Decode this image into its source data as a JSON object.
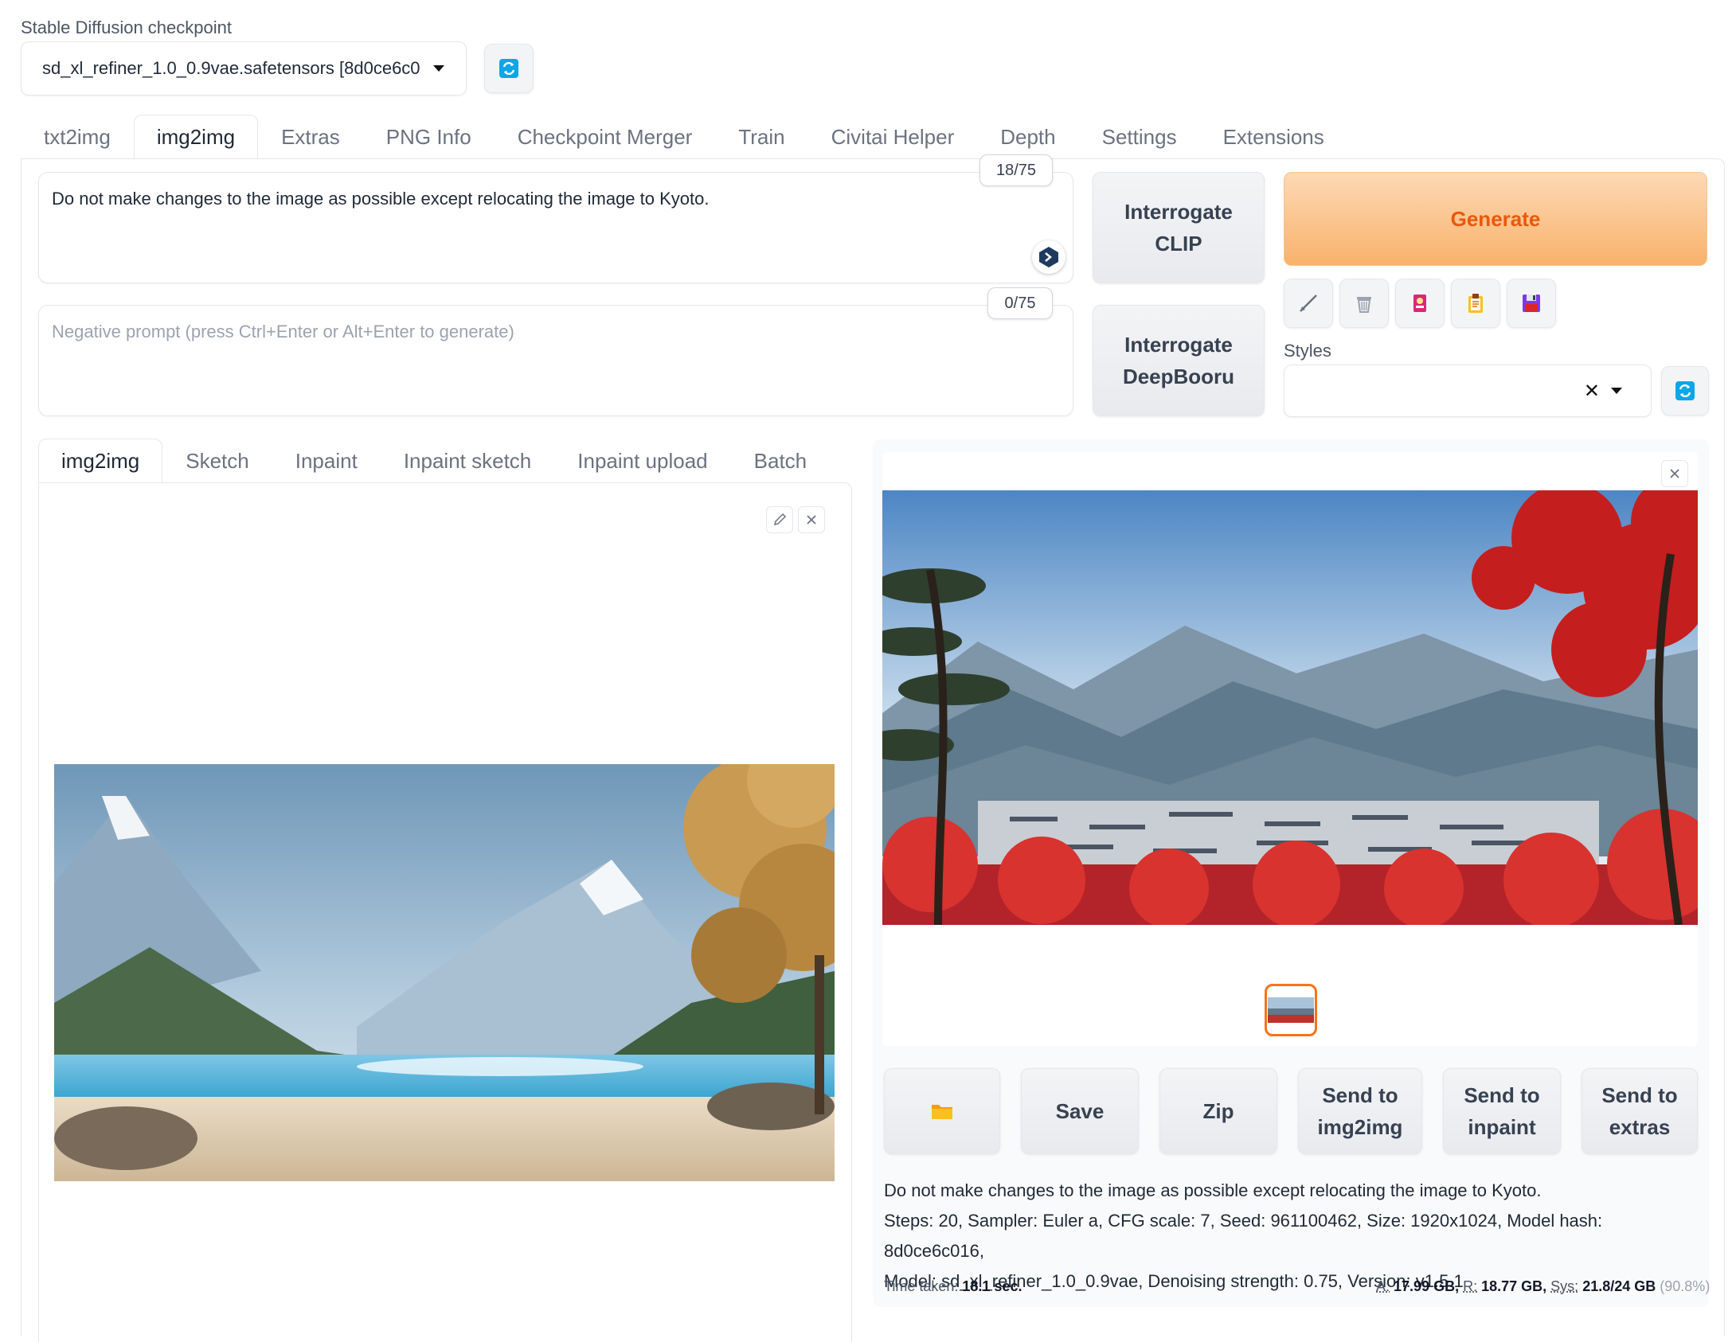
{
  "checkpoint": {
    "label": "Stable Diffusion checkpoint",
    "value": "sd_xl_refiner_1.0_0.9vae.safetensors [8d0ce6c0"
  },
  "main_tabs": [
    {
      "label": "txt2img",
      "active": false
    },
    {
      "label": "img2img",
      "active": true
    },
    {
      "label": "Extras",
      "active": false
    },
    {
      "label": "PNG Info",
      "active": false
    },
    {
      "label": "Checkpoint Merger",
      "active": false
    },
    {
      "label": "Train",
      "active": false
    },
    {
      "label": "Civitai Helper",
      "active": false
    },
    {
      "label": "Depth",
      "active": false
    },
    {
      "label": "Settings",
      "active": false
    },
    {
      "label": "Extensions",
      "active": false
    }
  ],
  "prompt": {
    "value": "Do not make changes to the image as possible except relocating the image to Kyoto.",
    "counter": "18/75"
  },
  "negative_prompt": {
    "placeholder": "Negative prompt (press Ctrl+Enter or Alt+Enter to generate)",
    "counter": "0/75"
  },
  "interrogate_clip": {
    "line1": "Interrogate",
    "line2": "CLIP"
  },
  "interrogate_deepbooru": {
    "line1": "Interrogate",
    "line2": "DeepBooru"
  },
  "generate_label": "Generate",
  "styles_label": "Styles",
  "sub_tabs": [
    {
      "label": "img2img",
      "active": true
    },
    {
      "label": "Sketch",
      "active": false
    },
    {
      "label": "Inpaint",
      "active": false
    },
    {
      "label": "Inpaint sketch",
      "active": false
    },
    {
      "label": "Inpaint upload",
      "active": false
    },
    {
      "label": "Batch",
      "active": false
    }
  ],
  "output_buttons": {
    "save": "Save",
    "zip": "Zip",
    "send_img2img": {
      "line1": "Send to",
      "line2": "img2img"
    },
    "send_inpaint": {
      "line1": "Send to",
      "line2": "inpaint"
    },
    "send_extras": {
      "line1": "Send to",
      "line2": "extras"
    }
  },
  "generation_info": {
    "line1": "Do not make changes to the image as possible except relocating the image to Kyoto.",
    "line2": "Steps: 20, Sampler: Euler a, CFG scale: 7, Seed: 961100462, Size: 1920x1024, Model hash: 8d0ce6c016,",
    "line3": "Model: sd_xl_refiner_1.0_0.9vae, Denoising strength: 0.75, Version: v1.5.1"
  },
  "footer": {
    "time_label": "Time taken:",
    "time_value": "18.1 sec.",
    "a_label": "A:",
    "a_value": "17.99 GB,",
    "r_label": "R:",
    "r_value": "18.77 GB,",
    "sys_label": "Sys:",
    "sys_value": "21.8/24 GB",
    "sys_pct": "(90.8%)"
  },
  "colors": {
    "accent_orange": "#ea580c",
    "refresh_blue": "#0ea5e9"
  }
}
